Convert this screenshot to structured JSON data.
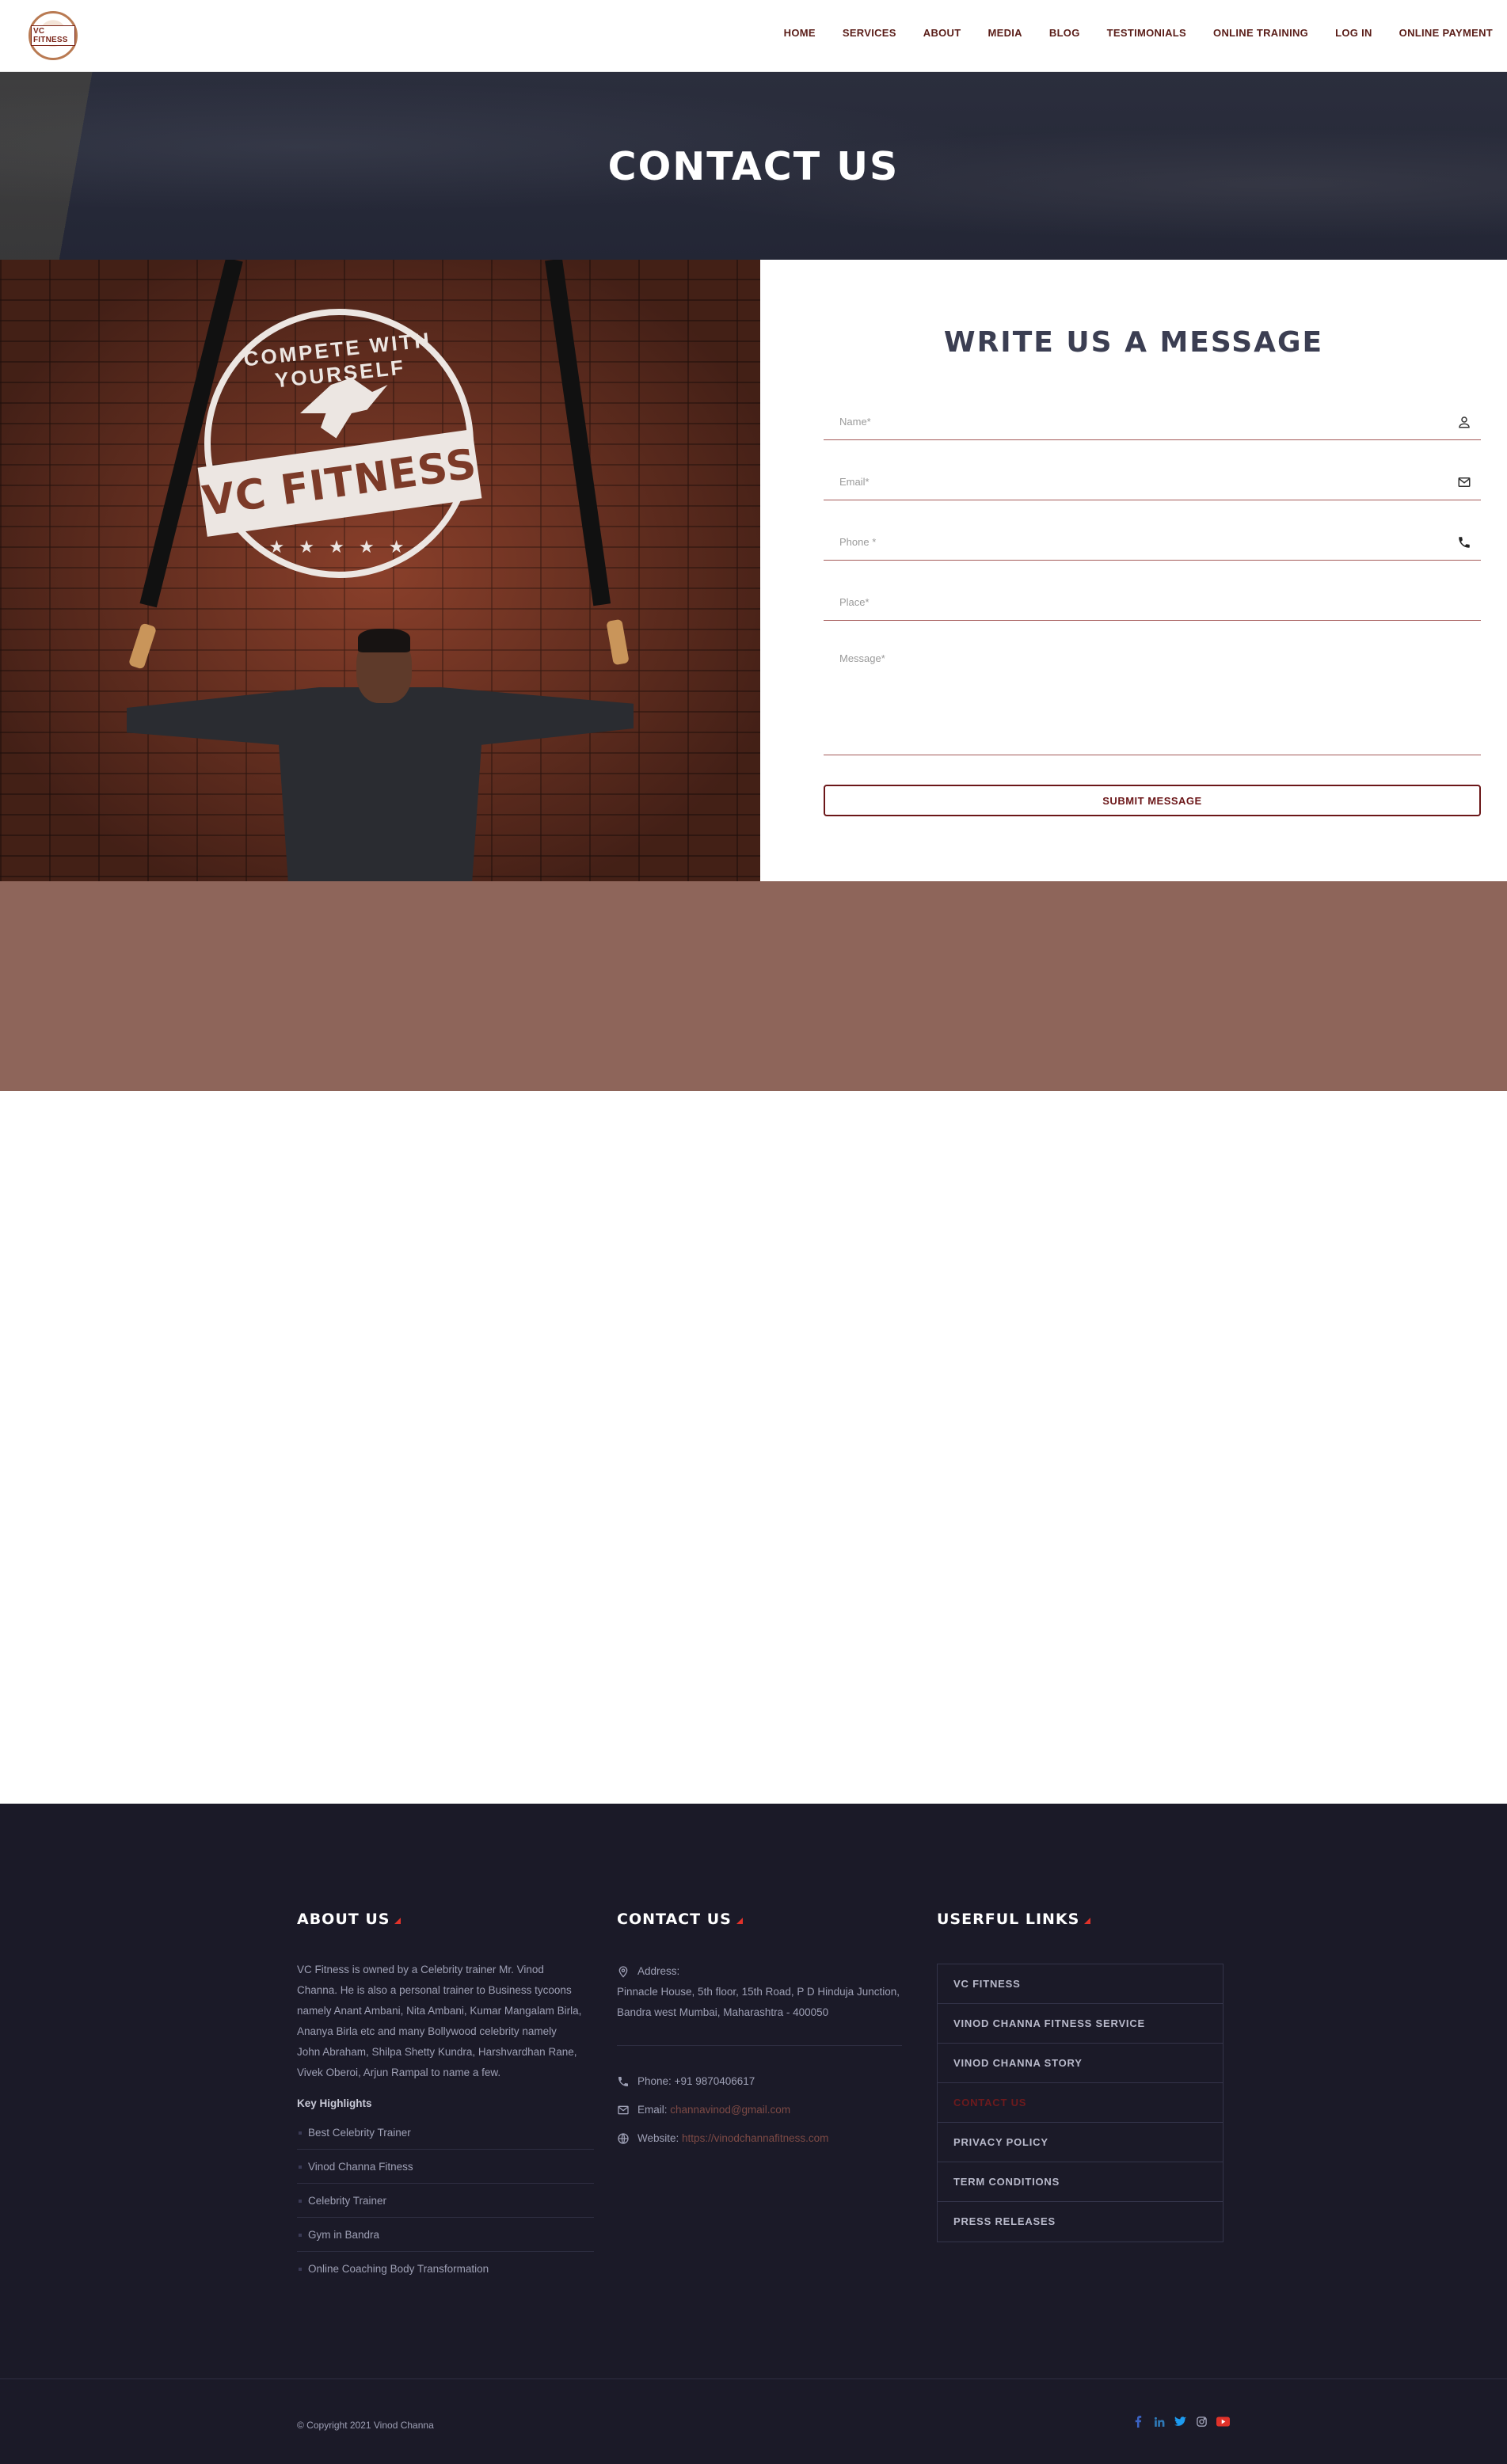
{
  "header": {
    "logo_text": "VC FITNESS",
    "nav": [
      "HOME",
      "SERVICES",
      "ABOUT",
      "MEDIA",
      "BLOG",
      "TESTIMONIALS",
      "ONLINE TRAINING",
      "LOG IN",
      "ONLINE PAYMENT"
    ]
  },
  "hero": {
    "title": "CONTACT US"
  },
  "photo": {
    "emblem_ring_text": "COMPETE WITH YOURSELF",
    "emblem_banner_text": "VC FITNESS"
  },
  "form": {
    "title": "WRITE US A MESSAGE",
    "name_placeholder": "Name*",
    "email_placeholder": "Email*",
    "phone_placeholder": "Phone *",
    "place_placeholder": "Place*",
    "message_placeholder": "Message*",
    "submit_label": "SUBMIT MESSAGE"
  },
  "footer": {
    "about": {
      "title": "ABOUT US",
      "text": "VC Fitness is owned by a Celebrity trainer Mr. Vinod Channa. He is also a personal trainer to Business tycoons namely Anant Ambani, Nita Ambani, Kumar Mangalam Birla, Ananya Birla etc and many Bollywood celebrity namely John Abraham, Shilpa Shetty Kundra, Harshvardhan Rane, Vivek Oberoi, Arjun Rampal to name a few.",
      "highlights_title": "Key Highlights",
      "highlights": [
        "Best Celebrity Trainer",
        "Vinod Channa Fitness",
        "Celebrity Trainer",
        "Gym in Bandra",
        "Online Coaching Body Transformation"
      ]
    },
    "contact": {
      "title": "CONTACT US",
      "address_label": "Address:",
      "address": "Pinnacle House, 5th floor, 15th Road, P D Hinduja Junction, Bandra west Mumbai, Maharashtra - 400050",
      "phone_label": "Phone:",
      "phone": "+91 9870406617",
      "email_label": "Email:",
      "email": "channavinod@gmail.com",
      "website_label": "Website:",
      "website": "https://vinodchannafitness.com"
    },
    "links": {
      "title": "USERFUL LINKS",
      "items": [
        "VC FITNESS",
        "VINOD CHANNA FITNESS SERVICE",
        "VINOD CHANNA STORY",
        "CONTACT US",
        "PRIVACY POLICY",
        "TERM CONDITIONS",
        "PRESS RELEASES"
      ],
      "active_index": 3
    },
    "copyright": "© Copyright 2021 Vinod Channa",
    "socials": [
      "facebook-icon",
      "linkedin-icon",
      "twitter-icon",
      "instagram-icon",
      "youtube-icon"
    ]
  },
  "colors": {
    "accent": "#6b1618",
    "nav_text": "#5a1d18",
    "map_band": "#8e655a",
    "footer_bg": "#1b1a28",
    "heading": "#3b3e52",
    "footer_accent": "#e0322a"
  }
}
